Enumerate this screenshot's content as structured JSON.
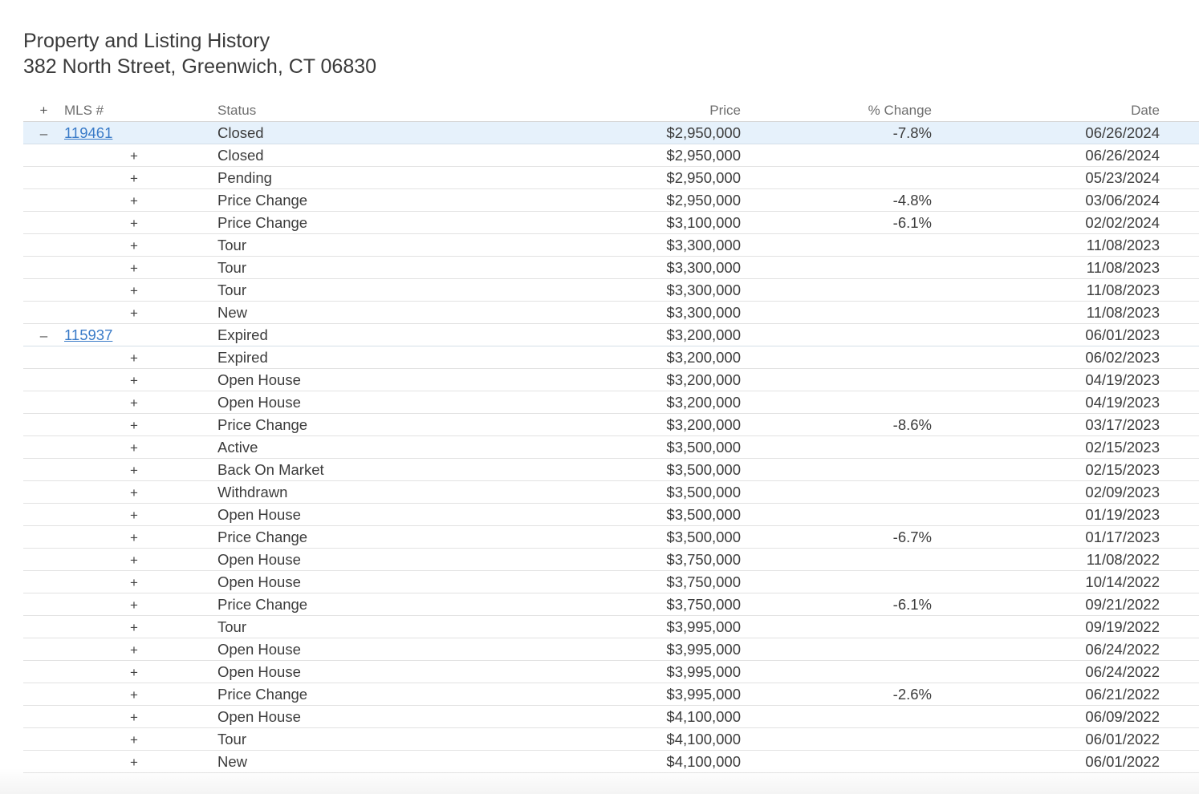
{
  "header": {
    "title": "Property and Listing History",
    "address": "382 North Street, Greenwich, CT 06830"
  },
  "table": {
    "columns": {
      "toggle": "+",
      "mls": "MLS #",
      "status": "Status",
      "price": "Price",
      "change": "% Change",
      "date": "Date"
    },
    "groups": [
      {
        "toggle": "–",
        "mls": "119461",
        "status": "Closed",
        "price": "$2,950,000",
        "change": "-7.8%",
        "date": "06/26/2024",
        "selected": true,
        "events": [
          {
            "toggle": "+",
            "status": "Closed",
            "price": "$2,950,000",
            "change": "",
            "date": "06/26/2024"
          },
          {
            "toggle": "+",
            "status": "Pending",
            "price": "$2,950,000",
            "change": "",
            "date": "05/23/2024"
          },
          {
            "toggle": "+",
            "status": "Price Change",
            "price": "$2,950,000",
            "change": "-4.8%",
            "date": "03/06/2024"
          },
          {
            "toggle": "+",
            "status": "Price Change",
            "price": "$3,100,000",
            "change": "-6.1%",
            "date": "02/02/2024"
          },
          {
            "toggle": "+",
            "status": "Tour",
            "price": "$3,300,000",
            "change": "",
            "date": "11/08/2023"
          },
          {
            "toggle": "+",
            "status": "Tour",
            "price": "$3,300,000",
            "change": "",
            "date": "11/08/2023"
          },
          {
            "toggle": "+",
            "status": "Tour",
            "price": "$3,300,000",
            "change": "",
            "date": "11/08/2023"
          },
          {
            "toggle": "+",
            "status": "New",
            "price": "$3,300,000",
            "change": "",
            "date": "11/08/2023"
          }
        ]
      },
      {
        "toggle": "–",
        "mls": "115937",
        "status": "Expired",
        "price": "$3,200,000",
        "change": "",
        "date": "06/01/2023",
        "selected": false,
        "events": [
          {
            "toggle": "+",
            "status": "Expired",
            "price": "$3,200,000",
            "change": "",
            "date": "06/02/2023"
          },
          {
            "toggle": "+",
            "status": "Open House",
            "price": "$3,200,000",
            "change": "",
            "date": "04/19/2023"
          },
          {
            "toggle": "+",
            "status": "Open House",
            "price": "$3,200,000",
            "change": "",
            "date": "04/19/2023"
          },
          {
            "toggle": "+",
            "status": "Price Change",
            "price": "$3,200,000",
            "change": "-8.6%",
            "date": "03/17/2023"
          },
          {
            "toggle": "+",
            "status": "Active",
            "price": "$3,500,000",
            "change": "",
            "date": "02/15/2023"
          },
          {
            "toggle": "+",
            "status": "Back On Market",
            "price": "$3,500,000",
            "change": "",
            "date": "02/15/2023"
          },
          {
            "toggle": "+",
            "status": "Withdrawn",
            "price": "$3,500,000",
            "change": "",
            "date": "02/09/2023"
          },
          {
            "toggle": "+",
            "status": "Open House",
            "price": "$3,500,000",
            "change": "",
            "date": "01/19/2023"
          },
          {
            "toggle": "+",
            "status": "Price Change",
            "price": "$3,500,000",
            "change": "-6.7%",
            "date": "01/17/2023"
          },
          {
            "toggle": "+",
            "status": "Open House",
            "price": "$3,750,000",
            "change": "",
            "date": "11/08/2022"
          },
          {
            "toggle": "+",
            "status": "Open House",
            "price": "$3,750,000",
            "change": "",
            "date": "10/14/2022"
          },
          {
            "toggle": "+",
            "status": "Price Change",
            "price": "$3,750,000",
            "change": "-6.1%",
            "date": "09/21/2022"
          },
          {
            "toggle": "+",
            "status": "Tour",
            "price": "$3,995,000",
            "change": "",
            "date": "09/19/2022"
          },
          {
            "toggle": "+",
            "status": "Open House",
            "price": "$3,995,000",
            "change": "",
            "date": "06/24/2022"
          },
          {
            "toggle": "+",
            "status": "Open House",
            "price": "$3,995,000",
            "change": "",
            "date": "06/24/2022"
          },
          {
            "toggle": "+",
            "status": "Price Change",
            "price": "$3,995,000",
            "change": "-2.6%",
            "date": "06/21/2022"
          },
          {
            "toggle": "+",
            "status": "Open House",
            "price": "$4,100,000",
            "change": "",
            "date": "06/09/2022"
          },
          {
            "toggle": "+",
            "status": "Tour",
            "price": "$4,100,000",
            "change": "",
            "date": "06/01/2022"
          },
          {
            "toggle": "+",
            "status": "New",
            "price": "$4,100,000",
            "change": "",
            "date": "06/01/2022"
          }
        ]
      }
    ]
  }
}
